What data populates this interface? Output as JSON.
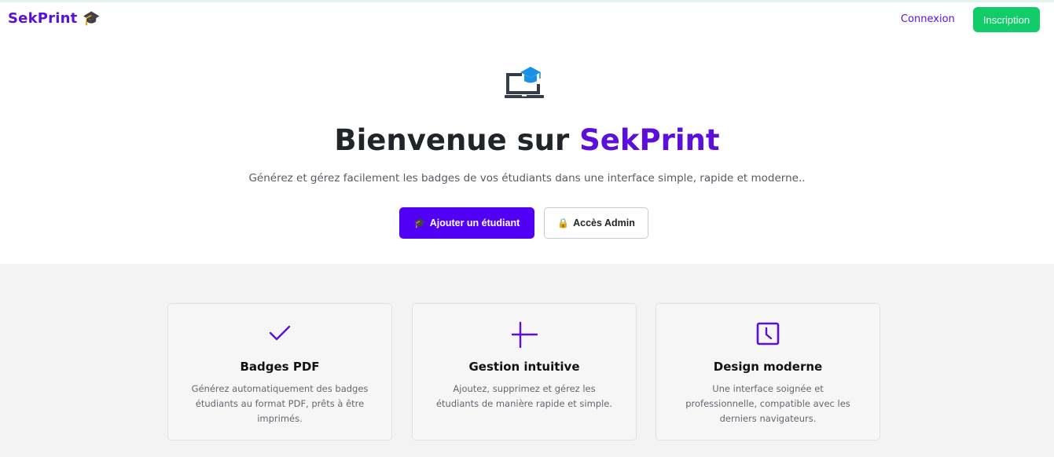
{
  "navbar": {
    "brand": "SekPrint",
    "brand_emoji": "🎓",
    "login_label": "Connexion",
    "signup_label": "Inscription"
  },
  "hero": {
    "icon": "laptop-graduation-cap-icon",
    "title_prefix": "Bienvenue sur",
    "title_accent": "SekPrint",
    "subtitle": "Générez et gérez facilement les badges de vos étudiants dans une interface simple, rapide et moderne..",
    "primary_button": {
      "icon": "🎓",
      "label": "Ajouter un étudiant"
    },
    "secondary_button": {
      "icon": "🔒",
      "label": "Accès Admin"
    }
  },
  "features": [
    {
      "icon": "check-icon",
      "title": "Badges PDF",
      "text": "Générez automatiquement des badges étudiants au format PDF, prêts à être imprimés."
    },
    {
      "icon": "plus-minus-icon",
      "title": "Gestion intuitive",
      "text": "Ajoutez, supprimez et gérez les étudiants de manière rapide et simple."
    },
    {
      "icon": "clock-icon",
      "title": "Design moderne",
      "text": "Une interface soignée et professionnelle, compatible avec les derniers navigateurs."
    }
  ],
  "colors": {
    "brand": "#5b0fd8",
    "primary_button": "#5200f5",
    "signup_button": "#10cd69",
    "features_bg": "#f3f3f4"
  }
}
